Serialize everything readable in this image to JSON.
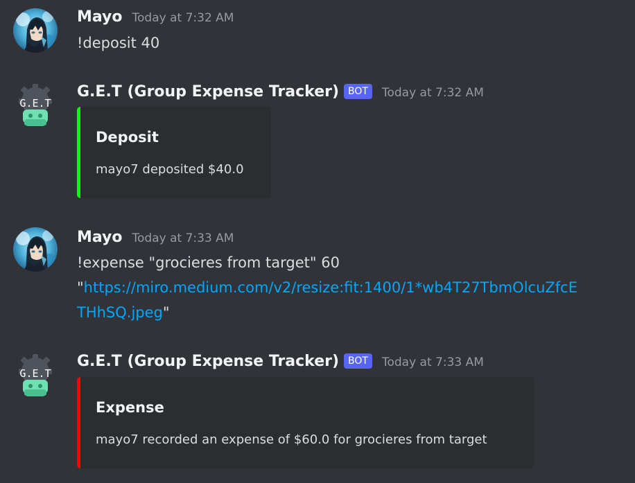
{
  "messages": [
    {
      "author": "Mayo",
      "timestamp": "Today at 7:32 AM",
      "text": "!deposit 40"
    },
    {
      "author": "G.E.T (Group Expense Tracker)",
      "bot_tag": "BOT",
      "timestamp": "Today at 7:32 AM",
      "avatar_text": "G.E.T",
      "embed": {
        "title": "Deposit",
        "description": "mayo7 deposited $40.0",
        "accent_color": "#00ff00"
      }
    },
    {
      "author": "Mayo",
      "timestamp": "Today at 7:33 AM",
      "text_line1": "!expense \"grocieres from target\" 60",
      "quote_open": "\"",
      "link_line1": "https://miro.medium.com/v2/resize:fit:1400/1*wb4T27TbmOlcuZfcE",
      "link_line2": "THhSQ.jpeg",
      "quote_close": "\""
    },
    {
      "author": "G.E.T (Group Expense Tracker)",
      "bot_tag": "BOT",
      "timestamp": "Today at 7:33 AM",
      "avatar_text": "G.E.T",
      "embed": {
        "title": "Expense",
        "description": "mayo7 recorded an expense of $60.0 for grocieres from target",
        "accent_color": "#ff0000"
      }
    }
  ],
  "colors": {
    "background": "#313338",
    "embed_background": "#2b2d31",
    "link": "#00a8fc",
    "bot_tag": "#5865f2",
    "timestamp": "#949ba4"
  },
  "icons": {
    "user_avatar": "anime-character-avatar",
    "bot_avatar": "robot-gear-avatar"
  }
}
